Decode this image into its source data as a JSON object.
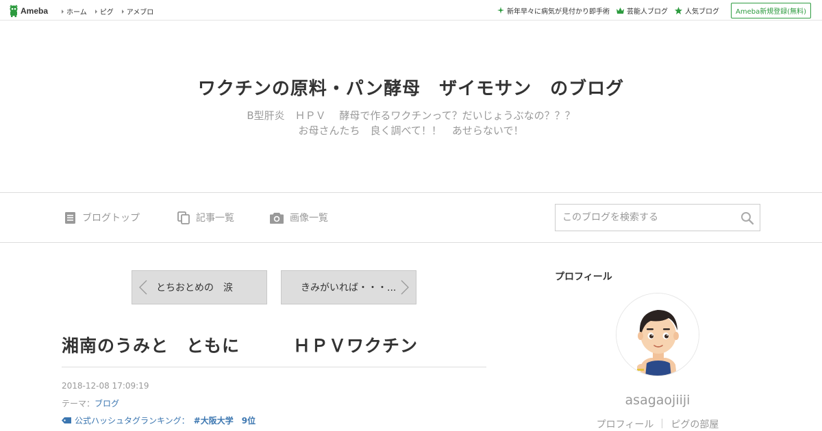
{
  "topbar": {
    "logo_text": "Ameba",
    "nav": [
      {
        "label": "ホーム"
      },
      {
        "label": "ピグ"
      },
      {
        "label": "アメブロ"
      }
    ],
    "right_links": [
      {
        "label": "新年早々に病気が見付かり即手術",
        "icon": "sparkle-icon"
      },
      {
        "label": "芸能人ブログ",
        "icon": "crown-icon"
      },
      {
        "label": "人気ブログ",
        "icon": "star-icon"
      }
    ],
    "register_label": "Ameba新規登録(無料)"
  },
  "header": {
    "title": "ワクチンの原料・パン酵母　ザイモサン　のブログ",
    "desc_line1": "B型肝炎　ＨＰＶ　 酵母で作るワクチンって？だいじょうぶなの？？？",
    "desc_line2": "お母さんたち　良く調べて！！　あせらないで！"
  },
  "nav": {
    "items": [
      {
        "label": "ブログトップ",
        "icon": "document-icon"
      },
      {
        "label": "記事一覧",
        "icon": "copy-icon"
      },
      {
        "label": "画像一覧",
        "icon": "camera-icon"
      }
    ],
    "search_placeholder": "このブログを検索する"
  },
  "article": {
    "prev_label": "とちおとめの　涙",
    "next_label": "きみがいれば・・・...",
    "title": "湘南のうみと　ともに　　　ＨＰＶワクチン",
    "date": "2018-12-08 17:09:19",
    "theme_prefix": "テーマ：",
    "theme_link": "ブログ",
    "hashtag_prefix": "公式ハッシュタグランキング：",
    "hashtag": "#大阪大学",
    "hashtag_rank": "9位"
  },
  "sidebar": {
    "heading": "プロフィール",
    "name": "asagaojiiji",
    "links": [
      {
        "label": "プロフィール"
      },
      {
        "label": "ピグの部屋"
      }
    ]
  },
  "colors": {
    "brand_green": "#2d9b3f",
    "link_blue": "#3b76b0",
    "muted": "#999999"
  }
}
